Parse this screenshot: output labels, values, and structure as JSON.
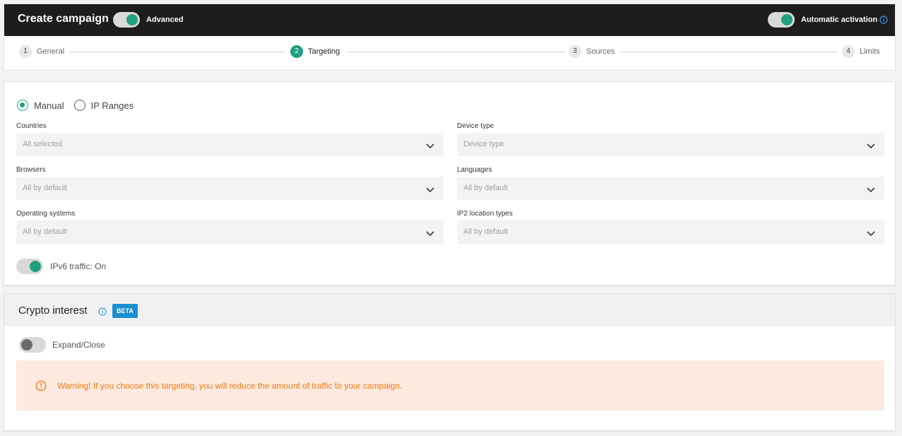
{
  "header": {
    "title": "Create campaign",
    "advanced_label": "Advanced",
    "advanced_on": true,
    "auto_activation_label": "Automatic activation",
    "auto_activation_on": true
  },
  "stepper": {
    "steps": [
      {
        "num": "1",
        "label": "General",
        "active": false
      },
      {
        "num": "2",
        "label": "Targeting",
        "active": true
      },
      {
        "num": "3",
        "label": "Sources",
        "active": false
      },
      {
        "num": "4",
        "label": "Limits",
        "active": false
      }
    ]
  },
  "targeting": {
    "mode_options": [
      "Manual",
      "IP Ranges"
    ],
    "mode_selected": "Manual",
    "fields": {
      "countries": {
        "label": "Countries",
        "value": "All selected"
      },
      "device_type": {
        "label": "Device type",
        "value": "Device type"
      },
      "browsers": {
        "label": "Browsers",
        "value": "All by default"
      },
      "languages": {
        "label": "Languages",
        "value": "All by default"
      },
      "operating_systems": {
        "label": "Operating systems",
        "value": "All by default"
      },
      "ip2_location_types": {
        "label": "IP2 location types",
        "value": "All by default"
      }
    },
    "ipv6_label": "IPv6 traffic: On",
    "ipv6_on": true
  },
  "crypto": {
    "title": "Crypto interest",
    "badge": "BETA",
    "expand_label": "Expand/Close",
    "expand_on": false,
    "warning": "Warning! If you choose this targeting, you will reduce the amount of traffic to your campaign."
  },
  "colors": {
    "accent": "#1fa07f",
    "header_bg": "#1d1d1d",
    "beta_bg": "#1a8fd0",
    "warning_text": "#f07a19",
    "warning_bg": "#fde9de"
  },
  "icons": {
    "info": "info-icon",
    "chevron": "chevron-down-icon",
    "warning": "warning-circle-icon"
  }
}
